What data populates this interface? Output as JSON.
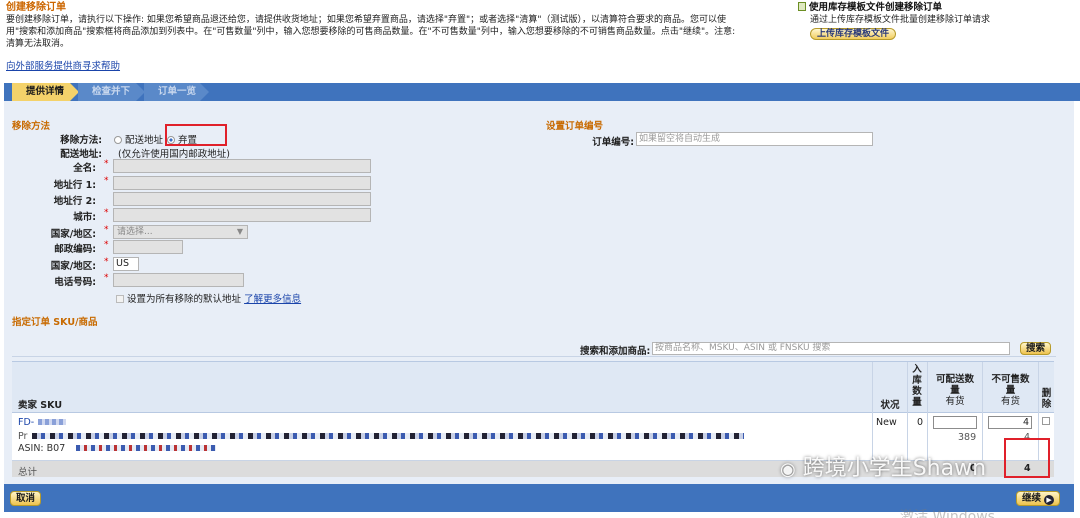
{
  "intro": {
    "title": "创建移除订单",
    "desc_line1": "要创建移除订单，请执行以下操作: 如果您希望商品退还给您，请提供收货地址；如果您希望弃置商品，请选择\"弃置\"；或者选择\"清算\"（测试版），以清算符合要求的商品。您可以使",
    "desc_line2": "用\"搜索和添加商品\"搜索框将商品添加到列表中。在\"可售数量\"列中，输入您想要移除的可售商品数量。在\"不可售数量\"列中，输入您想要移除的不可销售商品数量。点击\"继续\"。注意:",
    "desc_line3": "清算无法取消。",
    "help_link": "向外部服务提供商寻求帮助"
  },
  "template": {
    "title": "使用库存模板文件创建移除订单",
    "desc": "通过上传库存模板文件批量创建移除订单请求",
    "button": "上传库存模板文件"
  },
  "steps": [
    "提供详情",
    "检查并下单",
    "订单一览"
  ],
  "removal": {
    "section_title": "移除方法",
    "method_label": "移除方法:",
    "option_ship": "配送地址",
    "option_dispose": "弃置",
    "address_label": "配送地址:",
    "address_note": "(仅允许使用国内邮政地址)",
    "fields": {
      "full_name": "全名:",
      "addr1": "地址行 1:",
      "addr2": "地址行 2:",
      "city": "城市:",
      "country": "国家/地区:",
      "country_placeholder": "请选择...",
      "zip": "邮政编码:",
      "country2": "国家/地区:",
      "country2_value": "US",
      "phone": "电话号码:"
    },
    "default_addr": "设置为所有移除的默认地址",
    "learn_more": "了解更多信息"
  },
  "order": {
    "section_title": "设置订单编号",
    "label": "订单编号:",
    "placeholder": "如果留空将自动生成"
  },
  "sku": {
    "section_title": "指定订单 SKU/商品",
    "search_label": "搜索和添加商品:",
    "search_placeholder": "按商品名称、MSKU、ASIN 或 FNSKU 搜索",
    "search_button": "搜索",
    "headers": {
      "sku": "卖家 SKU",
      "condition": "状况",
      "inbound": [
        "入",
        "库",
        "数",
        "量"
      ],
      "sellable": [
        "可配送数",
        "量"
      ],
      "sellable_sub": "有货",
      "unsellable": [
        "不可售数",
        "量"
      ],
      "unsellable_sub": "有货",
      "delete": [
        "删",
        "除"
      ]
    },
    "row": {
      "sku_prefix": "FD-",
      "line2_prefix": "Pr",
      "line3_prefix": "ASIN: B07",
      "condition": "New",
      "inbound": "0",
      "sellable_value": "",
      "sellable_stock": "389",
      "unsellable_value": "4",
      "unsellable_stock": "4"
    },
    "total_label": "总计",
    "total_sellable": "0",
    "total_unsellable": "4"
  },
  "bottom": {
    "cancel": "取消",
    "continue": "继续"
  },
  "watermark": "跨境小学生Shawn",
  "windows_watermark": "激活 Windows"
}
